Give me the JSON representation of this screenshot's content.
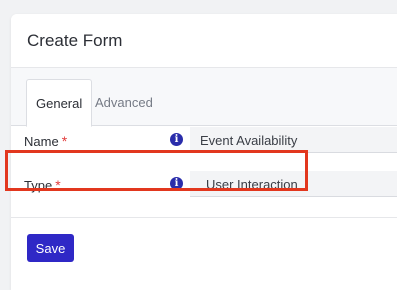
{
  "form": {
    "title": "Create Form",
    "tabs": [
      {
        "label": "General",
        "active": true
      },
      {
        "label": "Advanced",
        "active": false
      }
    ],
    "fields": [
      {
        "label": "Name",
        "required_mark": "*",
        "info_icon": "i",
        "value": "Event Availability"
      },
      {
        "label": "Type",
        "required_mark": "*",
        "info_icon": "i",
        "value": "User Interaction"
      }
    ],
    "save_label": "Save"
  },
  "colors": {
    "accent": "#2f28c6",
    "required": "#e23b3b",
    "highlight": "#e2371e",
    "info_icon": "#2a2dab"
  },
  "icons": [
    "info-icon"
  ]
}
